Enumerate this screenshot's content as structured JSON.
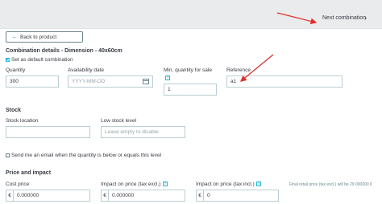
{
  "header": {
    "next_combination_label": "Next combination",
    "next_icon": "chevron-right-icon"
  },
  "back_button": {
    "label": "Back to product",
    "icon": "arrow-left-icon"
  },
  "title": "Combination details - Dimension - 40x60cm",
  "default_checkbox": {
    "label": "Set as default combination",
    "checked": true
  },
  "fields": {
    "quantity": {
      "label": "Quantity",
      "value": "300"
    },
    "availability": {
      "label": "Availability date",
      "placeholder": "YYYY-MM-DD"
    },
    "min_quantity": {
      "label": "Min. quantity for sale",
      "value": "1"
    },
    "reference": {
      "label": "Reference",
      "value": "a1"
    }
  },
  "stock": {
    "section_title": "Stock",
    "location_label": "Stock location",
    "location_value": "",
    "low_stock_label": "Low stock level",
    "low_stock_placeholder": "Leave empty to disable",
    "email_label": "Send me an email when the quantity is below or equals this level"
  },
  "price": {
    "section_title": "Price and impact",
    "cost_label": "Cost price",
    "cost_value": "0.000000",
    "impact_excl_label": "Impact on price (tax excl.)",
    "impact_excl_value": "0.000000",
    "impact_incl_label": "Impact on price (tax incl.)",
    "impact_incl_value": "0",
    "currency_symbol": "€",
    "final_price_note": "Final retail price (tax excl.) will be 29.000000 €"
  },
  "colors": {
    "accent": "#25b9d7",
    "annotation_red": "#e0302a",
    "topbar_bg": "#eaebec"
  }
}
